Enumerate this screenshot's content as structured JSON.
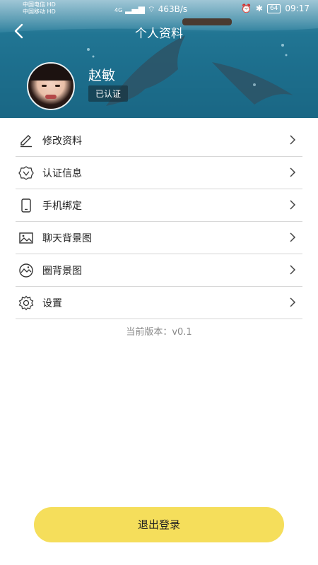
{
  "status_bar": {
    "carrier1": "中国电信",
    "carrier1_tag": "HD",
    "carrier2": "中国移动",
    "carrier2_tag": "HD",
    "network_tag": "4G",
    "net_speed": "463B/s",
    "battery": "64",
    "time": "09:17"
  },
  "navbar": {
    "title": "个人资料"
  },
  "profile": {
    "name": "赵敏",
    "badge": "已认证"
  },
  "menu": {
    "items": [
      {
        "label": "修改资料",
        "icon": "edit-icon"
      },
      {
        "label": "认证信息",
        "icon": "verified-icon"
      },
      {
        "label": "手机绑定",
        "icon": "phone-icon"
      },
      {
        "label": "聊天背景图",
        "icon": "image-icon"
      },
      {
        "label": "圈背景图",
        "icon": "landscape-icon"
      },
      {
        "label": "设置",
        "icon": "gear-icon"
      }
    ]
  },
  "version_text": "当前版本：v0.1",
  "logout_label": "退出登录"
}
